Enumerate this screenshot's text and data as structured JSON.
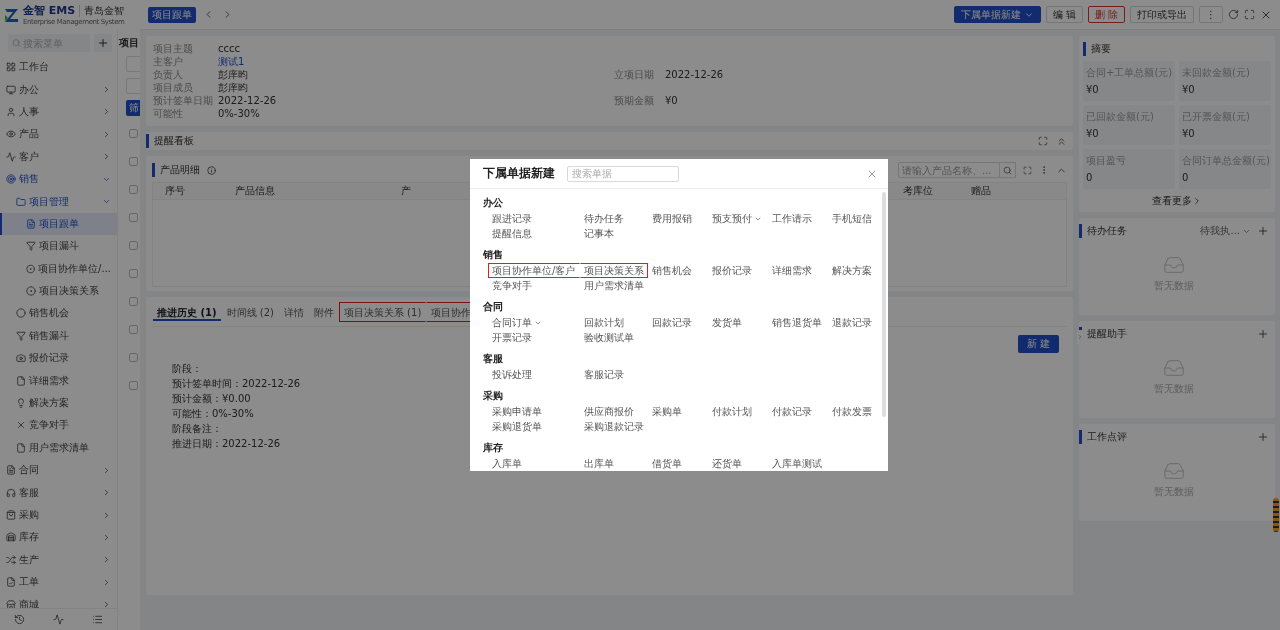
{
  "header": {
    "logo": "金智 EMS",
    "logo_subtitle": "Enterprise Management System",
    "company": "青岛金智"
  },
  "sidebar": {
    "search": {
      "placeholder": "搜索菜单"
    },
    "items": [
      {
        "label": "工作台",
        "selected": false
      },
      {
        "label": "办公",
        "selected": false,
        "expanded": false
      },
      {
        "label": "人事",
        "selected": false,
        "expanded": false
      },
      {
        "label": "产品",
        "selected": false,
        "expanded": false
      },
      {
        "label": "客户",
        "selected": false,
        "expanded": false
      },
      {
        "label": "销售",
        "selected": false,
        "expanded": true,
        "children": [
          {
            "label": "项目管理",
            "selected": false,
            "expanded": true,
            "children": [
              {
                "label": "项目跟单",
                "selected": true
              },
              {
                "label": "项目漏斗",
                "selected": false
              },
              {
                "label": "项目协作单位/...",
                "selected": false
              },
              {
                "label": "项目决策关系",
                "selected": false
              }
            ]
          },
          {
            "label": "销售机会",
            "selected": false
          },
          {
            "label": "销售漏斗",
            "selected": false
          },
          {
            "label": "报价记录",
            "selected": false
          },
          {
            "label": "详细需求",
            "selected": false
          },
          {
            "label": "解决方案",
            "selected": false
          },
          {
            "label": "竞争对手",
            "selected": false
          },
          {
            "label": "用户需求清单",
            "selected": false
          }
        ]
      },
      {
        "label": "合同",
        "selected": false,
        "expanded": false
      },
      {
        "label": "客服",
        "selected": false,
        "expanded": false
      },
      {
        "label": "采购",
        "selected": false,
        "expanded": false
      },
      {
        "label": "库存",
        "selected": false,
        "expanded": false
      },
      {
        "label": "生产",
        "selected": false,
        "expanded": false
      },
      {
        "label": "工单",
        "selected": false,
        "expanded": false
      },
      {
        "label": "商城",
        "selected": false,
        "expanded": false
      }
    ]
  },
  "list_panel": {
    "title": "项目",
    "filter_button": "筛",
    "rows": [
      {
        "checked": false
      },
      {
        "checked": false
      },
      {
        "checked": false
      },
      {
        "checked": false
      },
      {
        "checked": false
      },
      {
        "checked": false
      },
      {
        "checked": false
      },
      {
        "checked": false
      },
      {
        "checked": false
      },
      {
        "checked": false
      }
    ]
  },
  "drawer": {
    "tag": "项目跟单",
    "actions": [
      {
        "label": "下属单据新建",
        "kind": "primary",
        "dropdown": true
      },
      {
        "label": "编 辑",
        "kind": "default"
      },
      {
        "label": "删 除",
        "kind": "danger"
      },
      {
        "label": "打印或导出",
        "kind": "default"
      },
      {
        "label": "⋮",
        "kind": "default"
      }
    ],
    "info": [
      {
        "label": "项目主题",
        "value": "cccc",
        "link": false
      },
      {
        "label": "主客户",
        "value": "测试1",
        "link": true
      },
      {
        "label": "负责人",
        "value": "彭庠昀",
        "link": false,
        "side_label": "立项日期",
        "side_value": "2022-12-26"
      },
      {
        "label": "项目成员",
        "value": "彭庠昀",
        "link": false
      },
      {
        "label": "预计签单日期",
        "value": "2022-12-26",
        "link": false,
        "side_label": "预期金额",
        "side_value": "¥0"
      },
      {
        "label": "可能性",
        "value": "0%-30%",
        "link": false
      }
    ]
  },
  "reminder_board": {
    "title": "提醒看板"
  },
  "products": {
    "title": "产品明细",
    "search": {
      "placeholder": "请输入产品名称、..."
    },
    "columns": [
      "序号",
      "产品信息",
      "产",
      "考库位",
      "赠品"
    ]
  },
  "history": {
    "tabs": [
      {
        "label": "推进历史 (1)",
        "selected": true,
        "highlighted": false
      },
      {
        "label": "时间线 (2)",
        "selected": false,
        "highlighted": false
      },
      {
        "label": "详情",
        "selected": false,
        "highlighted": false
      },
      {
        "label": "附件",
        "selected": false,
        "highlighted": false
      },
      {
        "label": "项目决策关系 (1)",
        "selected": false,
        "highlighted": true
      },
      {
        "label": "项目协作",
        "selected": false,
        "highlighted": true
      }
    ],
    "new_button": "新 建",
    "lines": [
      "阶段：",
      "预计签单时间：2022-12-26",
      "预计金额：¥0.00",
      "可能性：0%-30%",
      "阶段备注：",
      "推进日期：2022-12-26"
    ]
  },
  "summary": {
    "title": "摘要",
    "stats": [
      {
        "label": "合同+工单总额(元)",
        "value": "¥0"
      },
      {
        "label": "未回款金额(元)",
        "value": "¥0"
      },
      {
        "label": "已回款金额(元)",
        "value": "¥0"
      },
      {
        "label": "已开票金额(元)",
        "value": "¥0"
      },
      {
        "label": "项目盈亏",
        "value": "0"
      },
      {
        "label": "合同订单总金额(元)",
        "value": "0"
      }
    ],
    "more": "查看更多"
  },
  "side_panels": [
    {
      "title": "待办任务",
      "filter": "待我执...",
      "empty": "暂无数据"
    },
    {
      "title": "提醒助手",
      "empty": "暂无数据"
    },
    {
      "title": "工作点评",
      "empty": "暂无数据"
    }
  ],
  "modal": {
    "title": "下属单据新建",
    "search": {
      "placeholder": "搜索单据"
    },
    "sections": [
      {
        "title": "办公",
        "items": [
          {
            "label": "跟进记录"
          },
          {
            "label": "待办任务"
          },
          {
            "label": "费用报销"
          },
          {
            "label": "预支预付",
            "dropdown": true
          },
          {
            "label": "工作请示"
          },
          {
            "label": "手机短信"
          },
          {
            "label": "提醒信息"
          },
          {
            "label": "记事本"
          }
        ]
      },
      {
        "title": "销售",
        "items": [
          {
            "label": "项目协作单位/客户",
            "highlighted": true
          },
          {
            "label": "项目决策关系",
            "highlighted": true
          },
          {
            "label": "销售机会"
          },
          {
            "label": "报价记录"
          },
          {
            "label": "详细需求"
          },
          {
            "label": "解决方案"
          },
          {
            "label": "竞争对手"
          },
          {
            "label": "用户需求清单"
          }
        ]
      },
      {
        "title": "合同",
        "items": [
          {
            "label": "合同订单",
            "dropdown": true
          },
          {
            "label": "回款计划"
          },
          {
            "label": "回款记录"
          },
          {
            "label": "发货单"
          },
          {
            "label": "销售退货单"
          },
          {
            "label": "退款记录"
          },
          {
            "label": "开票记录"
          },
          {
            "label": "验收测试单"
          }
        ]
      },
      {
        "title": "客服",
        "items": [
          {
            "label": "投诉处理"
          },
          {
            "label": "客服记录"
          }
        ]
      },
      {
        "title": "采购",
        "items": [
          {
            "label": "采购申请单"
          },
          {
            "label": "供应商报价"
          },
          {
            "label": "采购单"
          },
          {
            "label": "付款计划"
          },
          {
            "label": "付款记录"
          },
          {
            "label": "付款发票"
          },
          {
            "label": "采购退货单"
          },
          {
            "label": "采购退款记录"
          }
        ]
      },
      {
        "title": "库存",
        "items": [
          {
            "label": "入库单"
          },
          {
            "label": "出库单"
          },
          {
            "label": "借货单"
          },
          {
            "label": "还货单"
          },
          {
            "label": "入库单测试"
          }
        ]
      }
    ]
  }
}
